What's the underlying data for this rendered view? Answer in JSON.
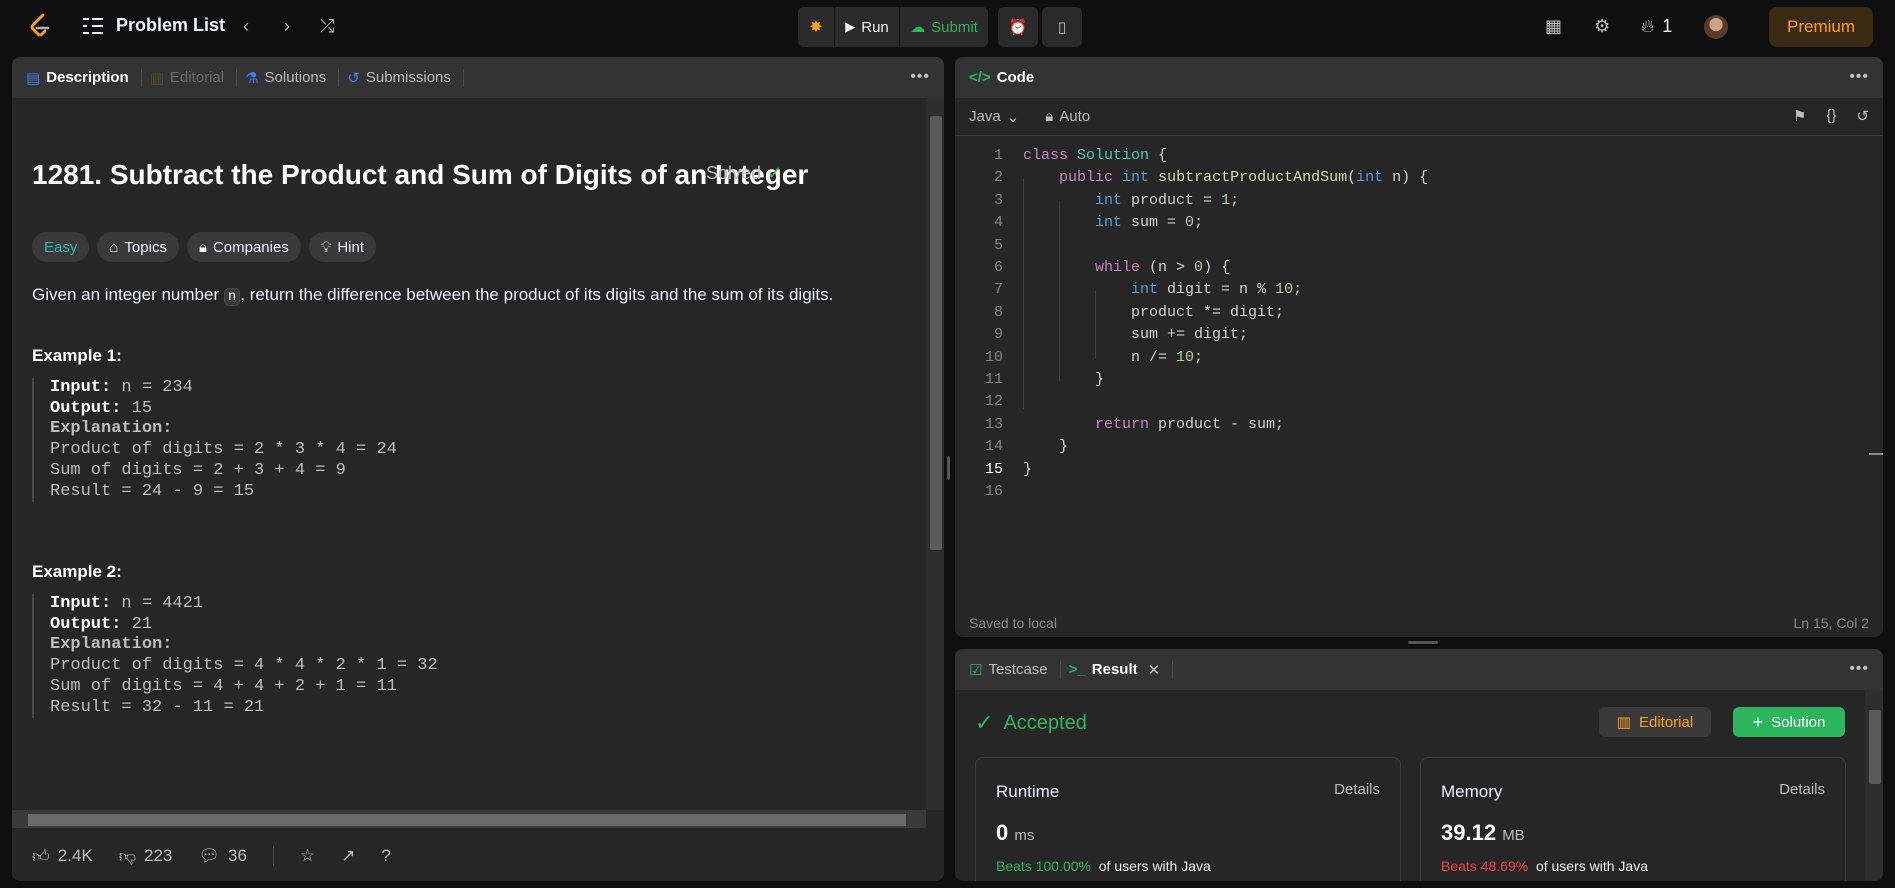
{
  "topbar": {
    "title": "Problem List",
    "run_label": "Run",
    "submit_label": "Submit",
    "streak_count": "1",
    "premium_label": "Premium"
  },
  "description_panel": {
    "tabs": [
      {
        "label": "Description",
        "icon": "description-icon"
      },
      {
        "label": "Editorial",
        "icon": "book-icon"
      },
      {
        "label": "Solutions",
        "icon": "flask-icon"
      },
      {
        "label": "Submissions",
        "icon": "history-icon"
      }
    ],
    "title": "1281. Subtract the Product and Sum of Digits of an Integer",
    "solved_label": "Solved",
    "chips": {
      "difficulty": "Easy",
      "topics": "Topics",
      "companies": "Companies",
      "hint": "Hint"
    },
    "statement_before": "Given an integer number ",
    "statement_code": "n",
    "statement_after": ", return the difference between the product of its digits and the sum of its digits.",
    "examples": [
      {
        "title": "Example 1:",
        "input_label": "Input:",
        "input_value": " n = 234",
        "output_label": "Output:",
        "output_value": " 15",
        "explanation_label": "Explanation:",
        "lines": [
          "Product of digits = 2 * 3 * 4 = 24",
          "Sum of digits = 2 + 3 + 4 = 9",
          "Result = 24 - 9 = 15"
        ]
      },
      {
        "title": "Example 2:",
        "input_label": "Input:",
        "input_value": " n = 4421",
        "output_label": "Output:",
        "output_value": " 21",
        "explanation_label": "Explanation:",
        "lines": [
          "Product of digits = 4 * 4 * 2 * 1 = 32",
          "Sum of digits = 4 + 4 + 2 + 1 = 11",
          "Result = 32 - 11 = 21"
        ]
      }
    ],
    "footer": {
      "likes": "2.4K",
      "dislikes": "223",
      "comments": "36"
    }
  },
  "code_panel": {
    "tab_label": "Code",
    "language": "Java",
    "auto_label": "Auto",
    "status_left": "Saved to local",
    "status_right": "Ln 15, Col 2",
    "current_line": 15,
    "lines": [
      "class Solution {",
      "    public int subtractProductAndSum(int n) {",
      "        int product = 1;",
      "        int sum = 0;",
      "",
      "        while (n > 0) {",
      "            int digit = n % 10;",
      "            product *= digit;",
      "            sum += digit;",
      "            n /= 10;",
      "        }",
      "",
      "        return product - sum;",
      "    }",
      "}",
      ""
    ]
  },
  "result_panel": {
    "testcase_label": "Testcase",
    "result_label": "Result",
    "status": "Accepted",
    "editorial_btn": "Editorial",
    "solution_btn": "Solution",
    "runtime": {
      "label": "Runtime",
      "details": "Details",
      "value": "0",
      "unit": "ms",
      "beats": "Beats 100.00%",
      "suffix": "of users with Java"
    },
    "memory": {
      "label": "Memory",
      "details": "Details",
      "value": "39.12",
      "unit": "MB",
      "beats": "Beats 48.69%",
      "suffix": "of users with Java"
    }
  },
  "colors": {
    "accent": "#ffa116",
    "success": "#2db55d",
    "easy": "#2cbbb0",
    "memory_beats": "#ef4743"
  }
}
